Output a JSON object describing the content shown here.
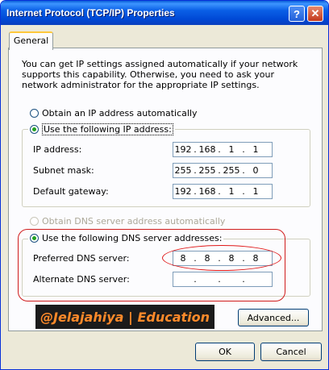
{
  "window": {
    "title": "Internet Protocol (TCP/IP) Properties",
    "help_label": "?",
    "close_label": "✕"
  },
  "tabs": [
    {
      "label": "General",
      "selected": true
    }
  ],
  "description": "You can get IP settings assigned automatically if your network supports this capability. Otherwise, you need to ask your network administrator for the appropriate IP settings.",
  "ip_section": {
    "auto_option": {
      "label": "Obtain an IP address automatically",
      "selected": false
    },
    "manual_option": {
      "label": "Use the following IP address:",
      "selected": true
    },
    "fields": [
      {
        "label": "IP address:",
        "octets": [
          "192",
          "168",
          "1",
          "1"
        ]
      },
      {
        "label": "Subnet mask:",
        "octets": [
          "255",
          "255",
          "255",
          "0"
        ]
      },
      {
        "label": "Default gateway:",
        "octets": [
          "192",
          "168",
          "1",
          "1"
        ]
      }
    ]
  },
  "dns_section": {
    "auto_option": {
      "label": "Obtain DNS server address automatically",
      "selected": false,
      "disabled": true
    },
    "manual_option": {
      "label": "Use the following DNS server addresses:",
      "selected": true
    },
    "fields": [
      {
        "label": "Preferred DNS server:",
        "octets": [
          "8",
          "8",
          "8",
          "8"
        ]
      },
      {
        "label": "Alternate DNS server:",
        "octets": [
          "",
          "",
          "",
          ""
        ]
      }
    ]
  },
  "watermark": "@Jelajahiya | Education",
  "buttons": {
    "advanced": "Advanced...",
    "ok": "OK",
    "cancel": "Cancel"
  },
  "colors": {
    "title_bar": "#0a5fe6",
    "dialog_bg": "#ece9d8",
    "highlight": "#e01818",
    "watermark_text": "#ff8a2a",
    "watermark_bg": "#1b1b1b"
  }
}
